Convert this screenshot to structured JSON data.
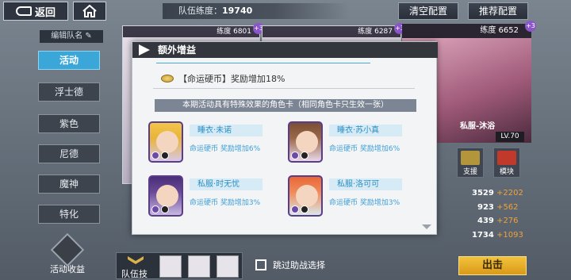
{
  "topbar": {
    "back_label": "返回",
    "team_power_label": "队伍练度：",
    "team_power_value": "19740",
    "clear_label": "清空配置",
    "recommend_label": "推荐配置"
  },
  "sidebar": {
    "edit_name_label": "编辑队名",
    "items": [
      {
        "label": "活动",
        "active": true
      },
      {
        "label": "浮士德",
        "active": false
      },
      {
        "label": "紫色",
        "active": false
      },
      {
        "label": "尼德",
        "active": false
      },
      {
        "label": "魔神",
        "active": false
      },
      {
        "label": "特化",
        "active": false
      }
    ],
    "activity_gain_label": "活动收益"
  },
  "cards": [
    {
      "power": "练度 6801",
      "level": "+3"
    },
    {
      "power": "练度 6287",
      "level": "+3"
    },
    {
      "power": "练度 6652",
      "level": "+3"
    }
  ],
  "hero": {
    "name": "私服-沐浴",
    "lv": "LV.70",
    "support_label": "支援",
    "module_label": "模块",
    "stats": [
      {
        "base": "3529",
        "bonus": "+2202"
      },
      {
        "base": "923",
        "bonus": "+562"
      },
      {
        "base": "439",
        "bonus": "+276"
      },
      {
        "base": "1734",
        "bonus": "+1093"
      }
    ]
  },
  "bottom": {
    "team_skill_label": "队伍技",
    "skip_label": "跳过助战选择",
    "go_label": "出击"
  },
  "modal": {
    "title": "额外增益",
    "bonus_text": "【命运硬币】奖励增加18%",
    "section_text": "本期活动具有特殊效果的角色卡（相同角色卡只生效一张）",
    "characters": [
      {
        "name": "睡衣·未诺",
        "bonus": "命运硬币 奖励增加6%",
        "hair": "#f2c54a"
      },
      {
        "name": "睡衣·苏小真",
        "bonus": "命运硬币 奖励增加6%",
        "hair": "#7a5036"
      },
      {
        "name": "私服·时无忧",
        "bonus": "命运硬币 奖励增加3%",
        "hair": "#4a2e78"
      },
      {
        "name": "私服·洛可可",
        "bonus": "命运硬币 奖励增加3%",
        "hair": "#e8683a"
      }
    ]
  }
}
